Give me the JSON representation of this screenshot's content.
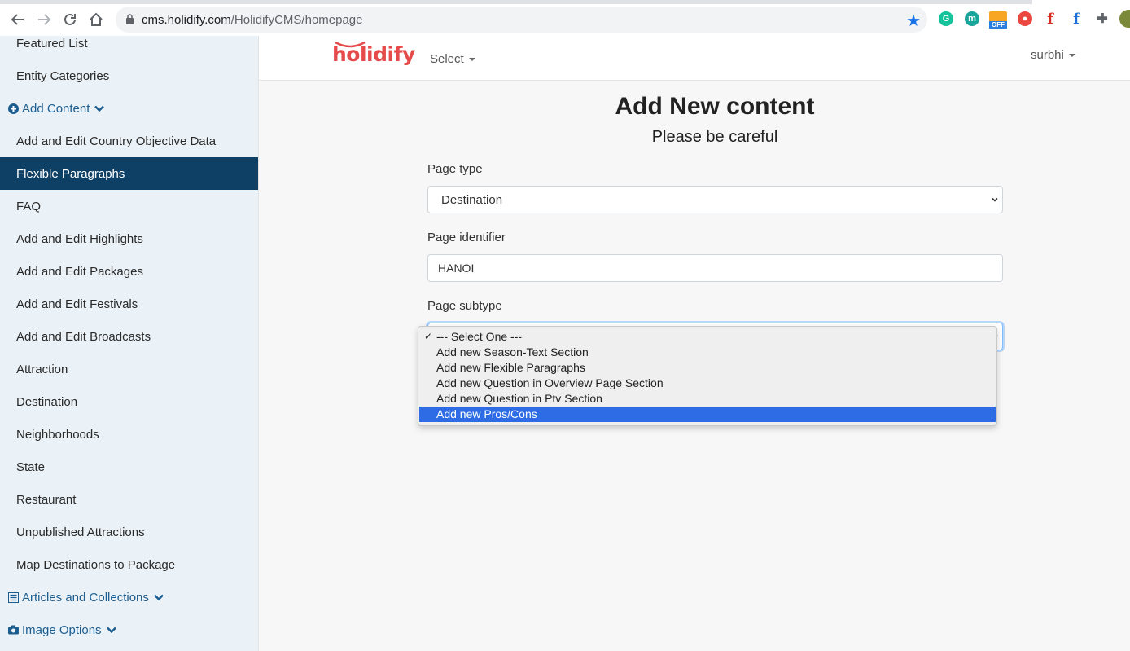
{
  "browser": {
    "url_host": "cms.holidify.com",
    "url_path": "/HolidifyCMS/homepage",
    "ext_off_badge": "OFF"
  },
  "sidebar": {
    "items": [
      {
        "label": "Featured List",
        "type": "item"
      },
      {
        "label": "Entity Categories",
        "type": "item"
      },
      {
        "label": "Add Content",
        "type": "group",
        "icon": "plus-circle-icon"
      },
      {
        "label": "Add and Edit Country Objective Data",
        "type": "item"
      },
      {
        "label": "Flexible Paragraphs",
        "type": "item",
        "active": true
      },
      {
        "label": "FAQ",
        "type": "item"
      },
      {
        "label": "Add and Edit Highlights",
        "type": "item"
      },
      {
        "label": "Add and Edit Packages",
        "type": "item"
      },
      {
        "label": "Add and Edit Festivals",
        "type": "item"
      },
      {
        "label": "Add and Edit Broadcasts",
        "type": "item"
      },
      {
        "label": "Attraction",
        "type": "item"
      },
      {
        "label": "Destination",
        "type": "item"
      },
      {
        "label": "Neighborhoods",
        "type": "item"
      },
      {
        "label": "State",
        "type": "item"
      },
      {
        "label": "Restaurant",
        "type": "item"
      },
      {
        "label": "Unpublished Attractions",
        "type": "item"
      },
      {
        "label": "Map Destinations to Package",
        "type": "item"
      },
      {
        "label": "Articles and Collections",
        "type": "group",
        "icon": "list-icon"
      },
      {
        "label": "Image Options",
        "type": "group",
        "icon": "camera-icon"
      }
    ]
  },
  "header": {
    "logo_text": "holidify",
    "select_menu": "Select",
    "user_menu": "surbhi"
  },
  "main": {
    "title": "Add New content",
    "subtitle": "Please be careful",
    "page_type_label": "Page type",
    "page_type_value": "Destination",
    "page_identifier_label": "Page identifier",
    "page_identifier_value": "HANOI",
    "page_subtype_label": "Page subtype"
  },
  "subtype_dropdown": {
    "options": [
      "--- Select One ---",
      "Add new Season-Text Section",
      "Add new Flexible Paragraphs",
      "Add new Question in Overview Page Section",
      "Add new Question in Ptv Section",
      "Add new Pros/Cons"
    ],
    "checked_option": "--- Select One ---",
    "highlighted_option": "Add new Pros/Cons"
  },
  "colors": {
    "sidebar_bg": "#ebf2f7",
    "sidebar_active_bg": "#0e4066",
    "group_link": "#1c5d90",
    "logo_red": "#e54b4b",
    "dropdown_highlight": "#2e6ce6"
  }
}
